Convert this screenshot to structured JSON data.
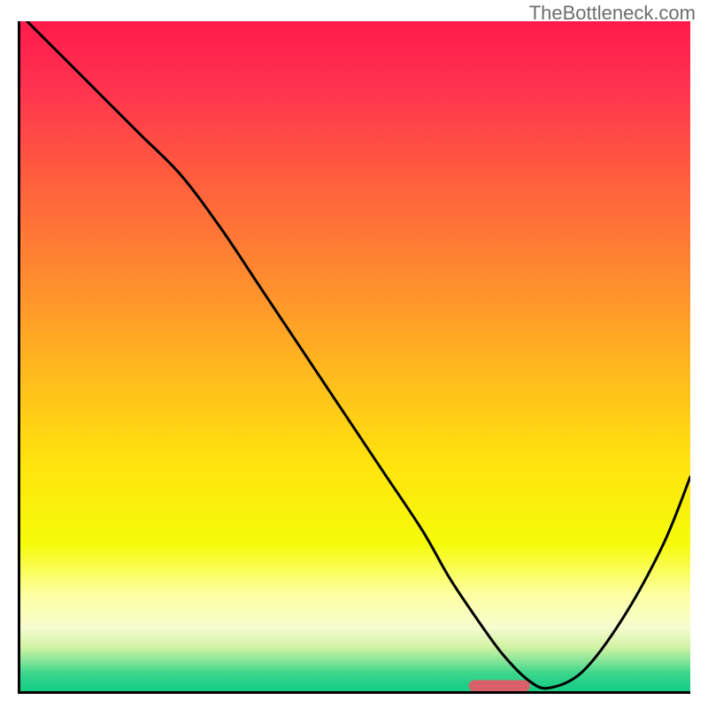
{
  "watermark": "TheBottleneck.com",
  "colors": {
    "line": "#000000",
    "marker_fill": "#d9606a",
    "marker_stroke": "#d9606a",
    "axis": "#000000"
  },
  "gradient_stops": [
    {
      "offset": 0.0,
      "color": "#ff1a4b"
    },
    {
      "offset": 0.1,
      "color": "#ff3350"
    },
    {
      "offset": 0.22,
      "color": "#ff593f"
    },
    {
      "offset": 0.38,
      "color": "#ff8a30"
    },
    {
      "offset": 0.52,
      "color": "#ffb81e"
    },
    {
      "offset": 0.66,
      "color": "#ffe40e"
    },
    {
      "offset": 0.78,
      "color": "#f5fb0a"
    },
    {
      "offset": 0.855,
      "color": "#fdffa0"
    },
    {
      "offset": 0.905,
      "color": "#f6fccf"
    },
    {
      "offset": 0.935,
      "color": "#d0f2a3"
    },
    {
      "offset": 0.955,
      "color": "#85e598"
    },
    {
      "offset": 0.972,
      "color": "#3fd78d"
    },
    {
      "offset": 0.99,
      "color": "#1fcf87"
    },
    {
      "offset": 1.0,
      "color": "#18cd85"
    }
  ],
  "chart_data": {
    "type": "line",
    "title": "",
    "xlabel": "",
    "ylabel": "",
    "xlim": [
      0,
      100
    ],
    "ylim": [
      0,
      100
    ],
    "x": [
      1,
      6,
      12,
      18,
      24,
      30,
      36,
      42,
      48,
      54,
      60,
      64,
      68,
      72,
      76,
      79,
      84,
      90,
      96,
      100
    ],
    "y": [
      100,
      95,
      89,
      83,
      77,
      69,
      60,
      51,
      42,
      33,
      24,
      17,
      11,
      5.5,
      1.5,
      0.5,
      3,
      11,
      22,
      32
    ],
    "marker": {
      "x_start": 67,
      "x_end": 76,
      "y": 0.8
    }
  }
}
